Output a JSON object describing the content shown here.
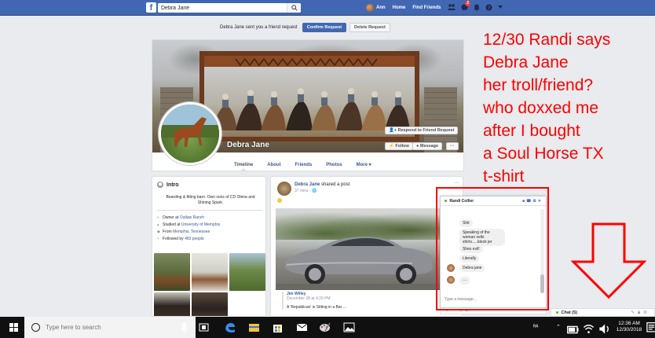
{
  "fb_nav": {
    "search_value": "Debra Jane",
    "user_name": "Ann",
    "home": "Home",
    "find_friends": "Find Friends",
    "messages_badge": "2"
  },
  "friend_request": {
    "text": "Debra Jane sent you a friend request",
    "confirm": "Confirm Request",
    "delete": "Delete Request"
  },
  "profile": {
    "name": "Debra Jane",
    "respond_button": "Respond to Friend Request",
    "follow_button": "Follow",
    "message_button": "Message",
    "more_button": "···",
    "tabs": [
      "Timeline",
      "About",
      "Friends",
      "Photos",
      "More ▾"
    ]
  },
  "intro": {
    "title": "Intro",
    "bio": "Boarding & fitting barn. Own sons of CD Olena and Shining Spark.",
    "owner_label": "Owner at",
    "owner_link": "Outlaw Ranch",
    "studied_label": "Studied at",
    "studied_link": "University of Memphis",
    "from_label": "From",
    "from_link": "Memphis, Tennessee",
    "followed_label": "Followed by",
    "followed_link": "483 people"
  },
  "post": {
    "author": "Debra Jane",
    "action": " shared a post",
    "time": "37 mins · 🌐",
    "more": "···",
    "shared_author": "Jim Willey",
    "shared_time": "December 28 at 4:29 PM",
    "shared_text": "A 'Republican' is Sitting in a Bar ..."
  },
  "chat": {
    "name": "Randi Collier",
    "bubbles": [
      "Shit",
      "Speaking of the woman sells shirts.....block jer",
      "Shes evil!",
      "Literally",
      "Debra jane",
      "···"
    ],
    "placeholder": "Type a message..."
  },
  "chat_bar": {
    "label": "Chat (5)"
  },
  "annotation": {
    "text": "12/30 Randi says\nDebra Jane\nher troll/friend?\nwho doxxed me\nafter I bought\na Soul Horse TX\nt-shirt"
  },
  "taskbar": {
    "search_placeholder": "Type here to search",
    "time": "12:36 AM",
    "date": "12/30/2018"
  },
  "colors": {
    "fb_blue": "#4267b2",
    "annotation_red": "#ff0000",
    "taskbar": "#101010"
  }
}
